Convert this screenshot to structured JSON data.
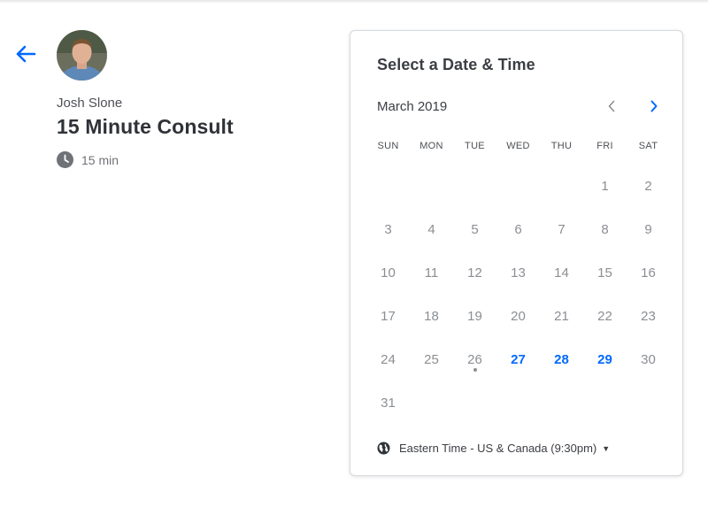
{
  "owner": {
    "name": "Josh Slone"
  },
  "event": {
    "title": "15 Minute Consult",
    "duration": "15 min"
  },
  "calendar": {
    "heading": "Select a Date & Time",
    "month": "March 2019",
    "weekdays": [
      "SUN",
      "MON",
      "TUE",
      "WED",
      "THU",
      "FRI",
      "SAT"
    ],
    "weeks": [
      [
        "",
        "",
        "",
        "",
        "",
        "1",
        "2"
      ],
      [
        "3",
        "4",
        "5",
        "6",
        "7",
        "8",
        "9"
      ],
      [
        "10",
        "11",
        "12",
        "13",
        "14",
        "15",
        "16"
      ],
      [
        "17",
        "18",
        "19",
        "20",
        "21",
        "22",
        "23"
      ],
      [
        "24",
        "25",
        "26",
        "27",
        "28",
        "29",
        "30"
      ],
      [
        "31",
        "",
        "",
        "",
        "",
        "",
        ""
      ]
    ],
    "available_days": [
      "27",
      "28",
      "29"
    ],
    "today": "26",
    "timezone": "Eastern Time - US & Canada (9:30pm)",
    "timezone_caret": "▼"
  },
  "colors": {
    "accent": "#0069ff",
    "muted_day": "#8b8e93",
    "title_text": "#2f3237"
  },
  "icons": {
    "back": "arrow-left-icon",
    "clock": "clock-icon",
    "prev": "chevron-left-icon",
    "next": "chevron-right-icon",
    "globe": "globe-icon"
  }
}
